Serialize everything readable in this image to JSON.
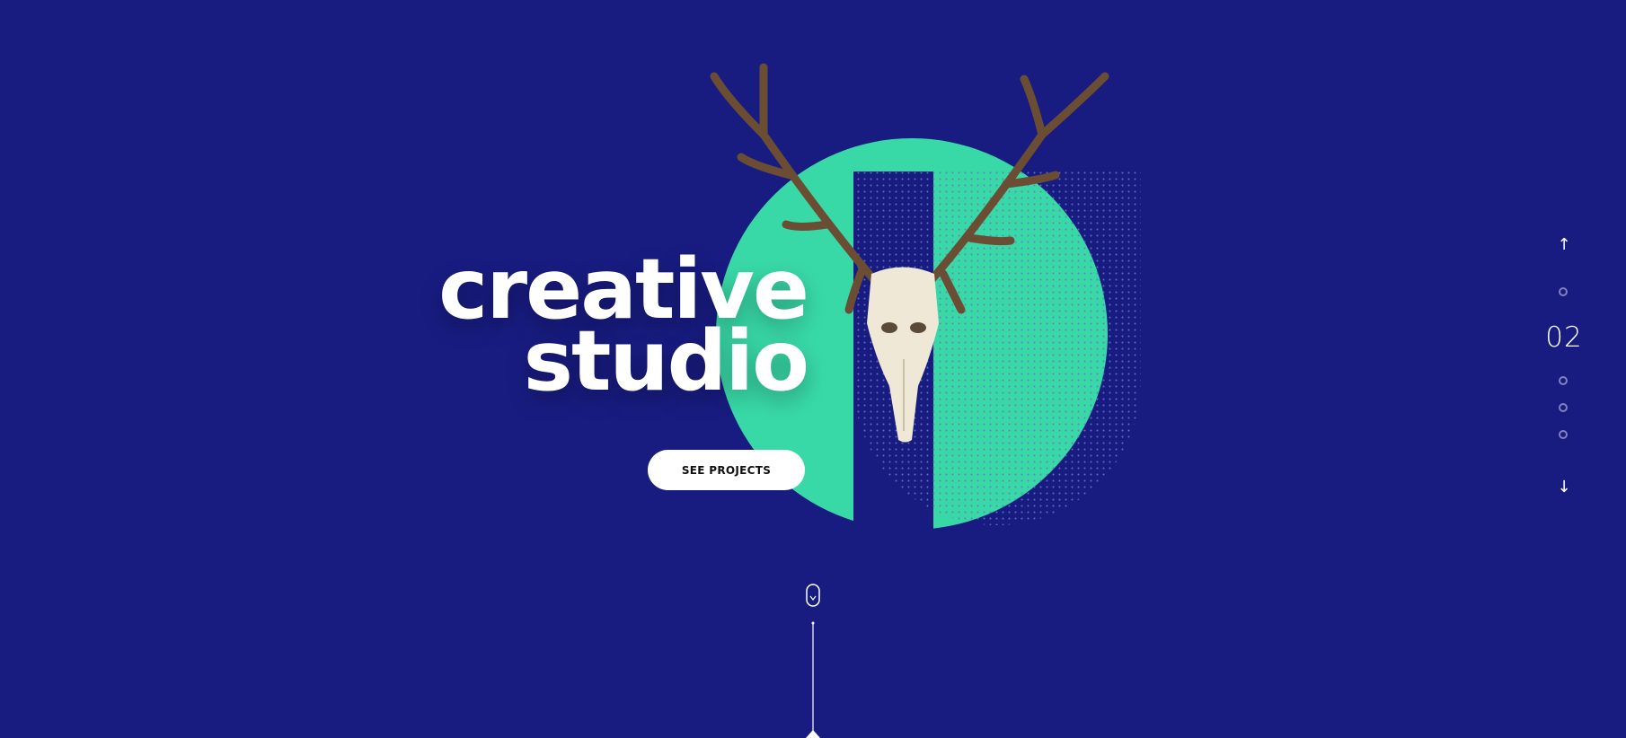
{
  "colors": {
    "background": "#181c80",
    "accent": "#39d9a7",
    "text": "#ffffff",
    "button_text": "#101010"
  },
  "hero": {
    "headline_line1": "creative",
    "headline_line2": "studio",
    "cta_label": "SEE PROJECTS"
  },
  "slider_nav": {
    "up_arrow": "↑",
    "down_arrow": "↓",
    "current_slide": "02",
    "total_dots": 4,
    "active_index": 2
  },
  "icons": [
    "deer-skull-image",
    "mouse-scroll-icon",
    "arrow-up-icon",
    "arrow-down-icon"
  ]
}
